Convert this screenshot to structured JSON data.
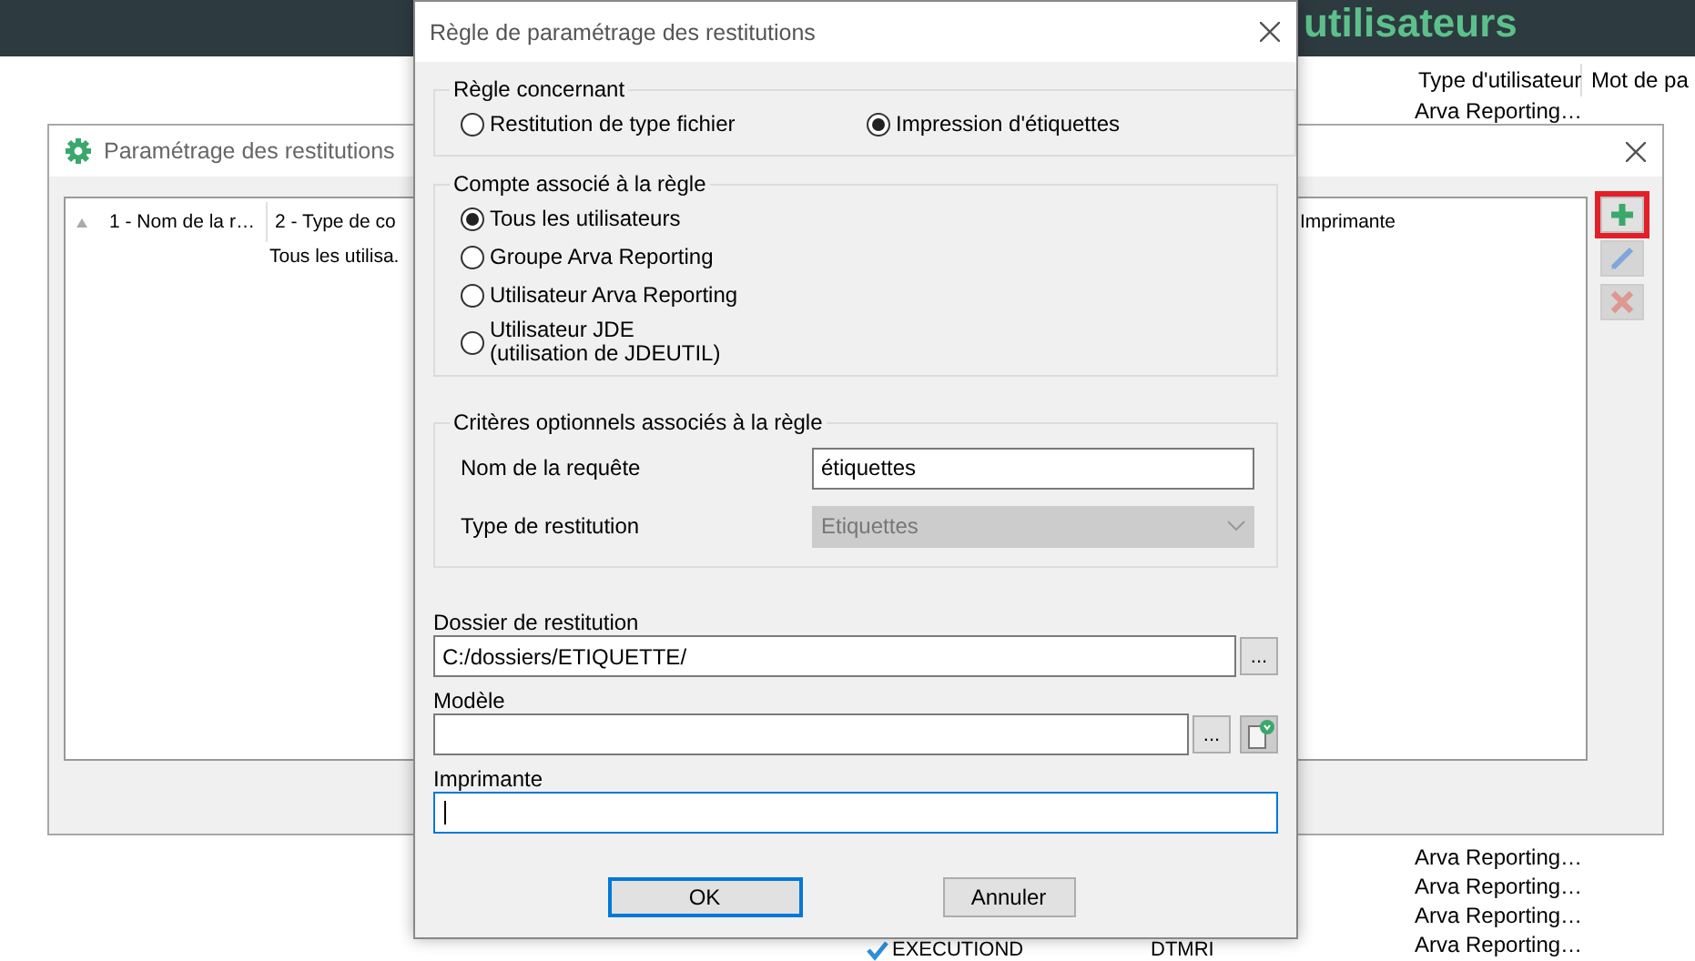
{
  "background_app": {
    "header_title": "utilisateurs",
    "columns": [
      "Type d'utilisateur",
      "Mot de pa"
    ],
    "rows_top": [
      "Arva Reporting…"
    ],
    "rows_bottom": [
      "Arva Reporting…",
      "Arva Reporting…",
      "Arva Reporting…",
      "Arva Reporting…"
    ],
    "job_row": {
      "name": "EXECUTIOND",
      "user": "DTMRI"
    }
  },
  "settings_window": {
    "title": "Paramétrage des restitutions",
    "list": {
      "columns": [
        "1 - Nom de la r…",
        "2 - Type de co",
        "Imprimante"
      ],
      "rows": [
        {
          "cells": [
            "",
            "Tous les utilisa."
          ]
        }
      ]
    },
    "tools": [
      {
        "kind": "add",
        "highlighted": true,
        "disabled": false
      },
      {
        "kind": "edit",
        "highlighted": false,
        "disabled": true
      },
      {
        "kind": "delete",
        "highlighted": false,
        "disabled": true
      }
    ]
  },
  "dialog": {
    "title": "Règle de paramétrage des restitutions",
    "rule_group": {
      "legend": "Règle concernant",
      "options": [
        {
          "label": "Restitution de type fichier",
          "selected": false
        },
        {
          "label": "Impression d'étiquettes",
          "selected": true
        }
      ]
    },
    "account_group": {
      "legend": "Compte associé à la règle",
      "options": [
        {
          "label": "Tous les utilisateurs",
          "selected": true
        },
        {
          "label": "Groupe Arva Reporting",
          "selected": false
        },
        {
          "label": "Utilisateur Arva Reporting",
          "selected": false
        },
        {
          "label": "Utilisateur JDE\n(utilisation de JDEUTIL)",
          "selected": false
        }
      ]
    },
    "criteria_group": {
      "legend": "Critères optionnels associés à la règle",
      "fields": [
        {
          "kind": "text",
          "label": "Nom de la requête",
          "value": "étiquettes",
          "disabled": false
        },
        {
          "kind": "select",
          "label": "Type de restitution",
          "value": "Etiquettes",
          "disabled": true
        }
      ]
    },
    "folder": {
      "label": "Dossier de restitution",
      "value": "C:/dossiers/ETIQUETTE/",
      "browse": "..."
    },
    "template": {
      "label": "Modèle",
      "browse": "..."
    },
    "printer": {
      "label": "Imprimante",
      "focused": true
    },
    "buttons": [
      {
        "label": "OK",
        "default": true
      },
      {
        "label": "Annuler",
        "default": false
      }
    ]
  }
}
